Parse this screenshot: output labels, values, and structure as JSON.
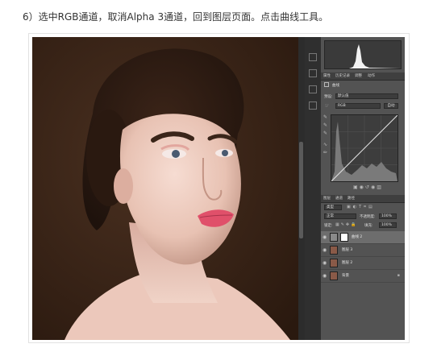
{
  "caption": "6）选中RGB通道，取消Alpha 3通道，回到图层页面。点击曲线工具。",
  "properties_panel": {
    "tabs": [
      "属性",
      "历史记录",
      "调整",
      "动作"
    ],
    "title": "曲线",
    "preset_label": "预设:",
    "preset_value": "默认值",
    "channel_value": "RGB",
    "auto_label": "自动"
  },
  "layers_panel": {
    "tabs": [
      "图层",
      "通道",
      "路径"
    ],
    "kind_filter": "类型",
    "blend_mode": "正常",
    "opacity_label": "不透明度:",
    "opacity_value": "100%",
    "lock_label": "锁定:",
    "fill_label": "填充:",
    "fill_value": "100%",
    "layers": [
      {
        "name": "曲线 2",
        "type": "adjustment",
        "selected": true
      },
      {
        "name": "图层 3",
        "type": "image",
        "selected": false
      },
      {
        "name": "图层 2",
        "type": "image",
        "selected": false
      },
      {
        "name": "背景",
        "type": "image",
        "selected": false
      }
    ]
  },
  "icons": {
    "eye": "eye-icon",
    "lock": "lock-icon",
    "curve_adjust": "curves-adjustment-icon",
    "eyedropper": "eyedropper-icon"
  },
  "colors": {
    "panel_bg": "#535353",
    "photo_bg": "#3b2618"
  }
}
